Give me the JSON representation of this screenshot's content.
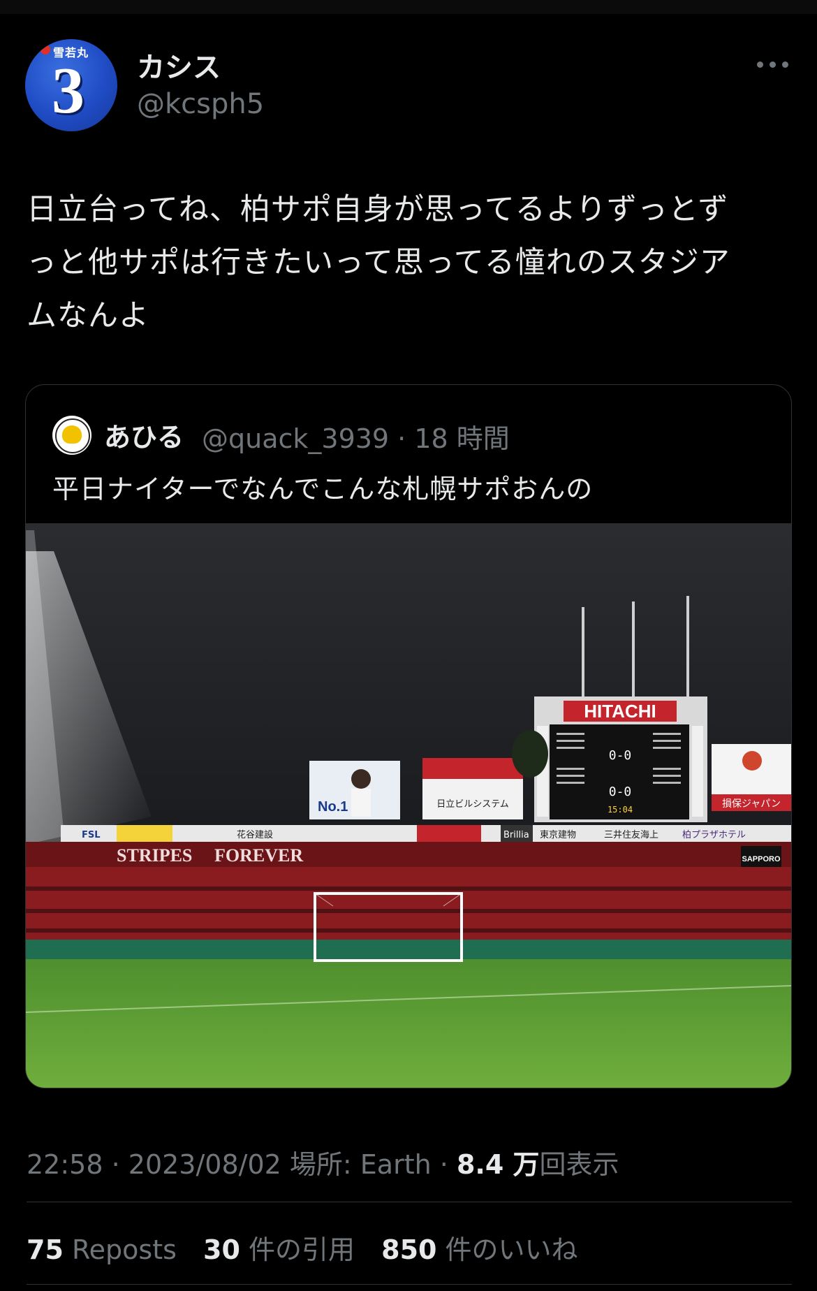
{
  "author": {
    "display_name": "カシス",
    "handle": "@kcsph5",
    "avatar_number": "3",
    "avatar_sponsor": "雪若丸"
  },
  "tweet": {
    "text_line1": "日立台ってね、柏サポ自身が思ってるよりずっとず",
    "text_line2": "っと他サポは行きたいって思ってる憧れのスタジア",
    "text_line3": "ムなんよ"
  },
  "quoted": {
    "display_name": "あひる",
    "handle_and_time": "@quack_3939 · 18 時間",
    "text": "平日ナイターでなんでこんな札幌サポおんの",
    "photo_signs": {
      "scoreboard_brand": "HITACHI",
      "score_top": "0-0",
      "score_bottom": "0-0",
      "clock": "15:04",
      "banner_left": "STRIPES",
      "banner_mid": "FOREVER",
      "ad_sompo": "損保ジャパン",
      "ad_hitachi_sys": "日立ビルシステム",
      "ad_no1": "No.1",
      "sign_sapporo": "SAPPORO",
      "board_fsl": "FSL",
      "board_hanaya": "花谷建設",
      "board_brillia": "Brillia",
      "board_tokyo": "東京建物",
      "board_mitsui": "三井住友海上",
      "board_plaza": "柏プラザホテル"
    }
  },
  "meta": {
    "time": "22:58",
    "date": "2023/08/02",
    "location_label": "場所: Earth",
    "views_count": "8.4 万",
    "views_label": "回表示"
  },
  "stats": {
    "reposts_count": "75",
    "reposts_label": "Reposts",
    "quotes_count": "30",
    "quotes_label": "件の引用",
    "likes_count": "850",
    "likes_label": "件のいいね"
  },
  "colors": {
    "background": "#000000",
    "text_primary": "#e7e9ea",
    "text_secondary": "#71767b",
    "border": "#2f3336"
  }
}
